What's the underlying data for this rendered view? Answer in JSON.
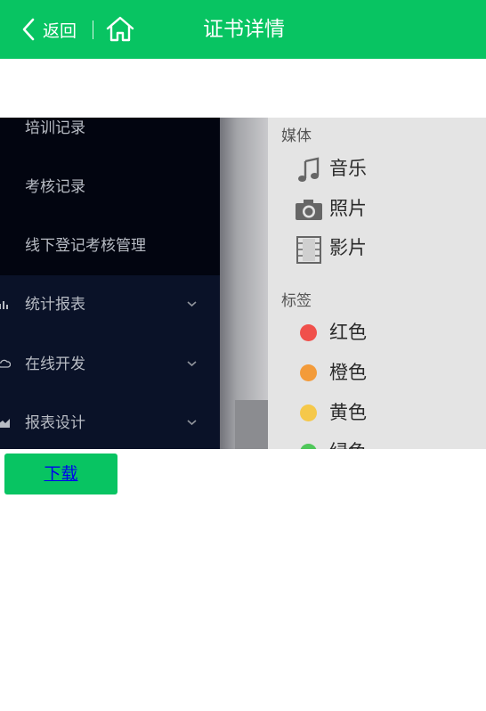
{
  "header": {
    "back_label": "返回",
    "title": "证书详情",
    "color": "#08c462"
  },
  "certificate_image": {
    "left_menu": [
      {
        "label": "培训记录",
        "icon": "",
        "expandable": false
      },
      {
        "label": "考核记录",
        "icon": "",
        "expandable": false
      },
      {
        "label": "线下登记考核管理",
        "icon": "",
        "expandable": false
      },
      {
        "label": "统计报表",
        "icon": "bar-chart-icon",
        "expandable": true
      },
      {
        "label": "在线开发",
        "icon": "cloud-icon",
        "expandable": true
      },
      {
        "label": "报表设计",
        "icon": "area-chart-icon",
        "expandable": true
      }
    ],
    "finder": {
      "media_title": "媒体",
      "media_items": [
        {
          "label": "音乐",
          "icon": "music-icon"
        },
        {
          "label": "照片",
          "icon": "camera-icon"
        },
        {
          "label": "影片",
          "icon": "film-icon"
        }
      ],
      "tags_title": "标签",
      "tags": [
        {
          "label": "红色",
          "color": "#f0504b"
        },
        {
          "label": "橙色",
          "color": "#f39b3a"
        },
        {
          "label": "黄色",
          "color": "#f5c84a"
        },
        {
          "label": "绿色",
          "color": "#4fc75a"
        }
      ]
    }
  },
  "download": {
    "label": "下载"
  }
}
